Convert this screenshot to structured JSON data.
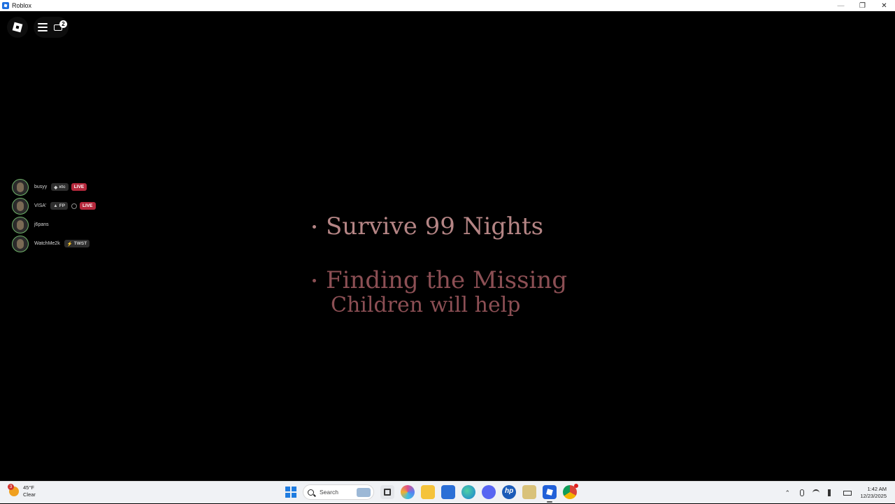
{
  "window": {
    "title": "Roblox"
  },
  "topbar": {
    "chat_badge": "2"
  },
  "players": [
    {
      "name": "busyy",
      "tag": "xtc",
      "tag_icon": "diamond-icon",
      "live": "LIVE"
    },
    {
      "name": "VISA'",
      "tag": "FP",
      "tag_icon": "drop-icon",
      "live": "LIVE"
    },
    {
      "name": "j6pans",
      "tag": "",
      "tag_icon": "",
      "live": ""
    },
    {
      "name": "WatchMe2k",
      "tag": "TWST",
      "tag_icon": "bolt-icon",
      "live": ""
    }
  ],
  "objectives": {
    "line1": "Survive 99 Nights",
    "line2": "Finding the Missing",
    "line3": "Children will help"
  },
  "taskbar": {
    "weather_temp": "45°F",
    "weather_desc": "Clear",
    "weather_badge": "3",
    "search_placeholder": "Search",
    "time": "1:42 AM",
    "date": "12/23/2025"
  },
  "colors": {
    "objective_primary": "#b58585",
    "objective_secondary": "#8c4f54",
    "live_badge": "#b5283c",
    "windows_blue": "#1f7ce0"
  }
}
